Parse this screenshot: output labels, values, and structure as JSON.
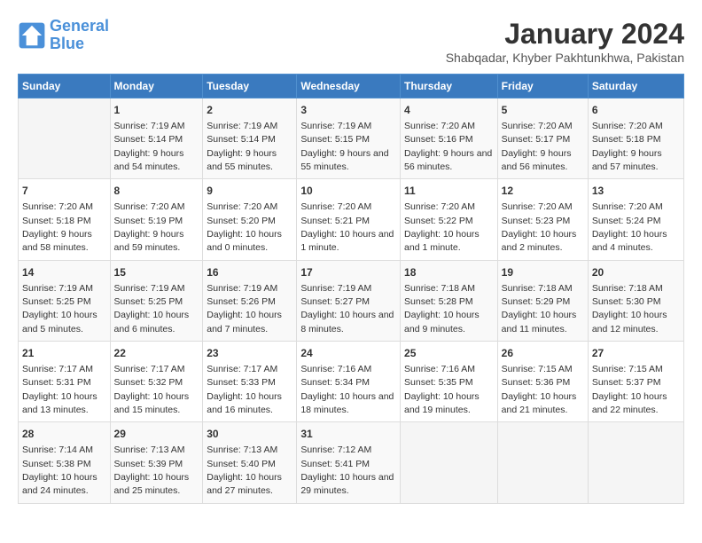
{
  "logo": {
    "line1": "General",
    "line2": "Blue"
  },
  "title": "January 2024",
  "subtitle": "Shabqadar, Khyber Pakhtunkhwa, Pakistan",
  "headers": [
    "Sunday",
    "Monday",
    "Tuesday",
    "Wednesday",
    "Thursday",
    "Friday",
    "Saturday"
  ],
  "weeks": [
    [
      {
        "day": "",
        "sunrise": "",
        "sunset": "",
        "daylight": ""
      },
      {
        "day": "1",
        "sunrise": "Sunrise: 7:19 AM",
        "sunset": "Sunset: 5:14 PM",
        "daylight": "Daylight: 9 hours and 54 minutes."
      },
      {
        "day": "2",
        "sunrise": "Sunrise: 7:19 AM",
        "sunset": "Sunset: 5:14 PM",
        "daylight": "Daylight: 9 hours and 55 minutes."
      },
      {
        "day": "3",
        "sunrise": "Sunrise: 7:19 AM",
        "sunset": "Sunset: 5:15 PM",
        "daylight": "Daylight: 9 hours and 55 minutes."
      },
      {
        "day": "4",
        "sunrise": "Sunrise: 7:20 AM",
        "sunset": "Sunset: 5:16 PM",
        "daylight": "Daylight: 9 hours and 56 minutes."
      },
      {
        "day": "5",
        "sunrise": "Sunrise: 7:20 AM",
        "sunset": "Sunset: 5:17 PM",
        "daylight": "Daylight: 9 hours and 56 minutes."
      },
      {
        "day": "6",
        "sunrise": "Sunrise: 7:20 AM",
        "sunset": "Sunset: 5:18 PM",
        "daylight": "Daylight: 9 hours and 57 minutes."
      }
    ],
    [
      {
        "day": "7",
        "sunrise": "Sunrise: 7:20 AM",
        "sunset": "Sunset: 5:18 PM",
        "daylight": "Daylight: 9 hours and 58 minutes."
      },
      {
        "day": "8",
        "sunrise": "Sunrise: 7:20 AM",
        "sunset": "Sunset: 5:19 PM",
        "daylight": "Daylight: 9 hours and 59 minutes."
      },
      {
        "day": "9",
        "sunrise": "Sunrise: 7:20 AM",
        "sunset": "Sunset: 5:20 PM",
        "daylight": "Daylight: 10 hours and 0 minutes."
      },
      {
        "day": "10",
        "sunrise": "Sunrise: 7:20 AM",
        "sunset": "Sunset: 5:21 PM",
        "daylight": "Daylight: 10 hours and 1 minute."
      },
      {
        "day": "11",
        "sunrise": "Sunrise: 7:20 AM",
        "sunset": "Sunset: 5:22 PM",
        "daylight": "Daylight: 10 hours and 1 minute."
      },
      {
        "day": "12",
        "sunrise": "Sunrise: 7:20 AM",
        "sunset": "Sunset: 5:23 PM",
        "daylight": "Daylight: 10 hours and 2 minutes."
      },
      {
        "day": "13",
        "sunrise": "Sunrise: 7:20 AM",
        "sunset": "Sunset: 5:24 PM",
        "daylight": "Daylight: 10 hours and 4 minutes."
      }
    ],
    [
      {
        "day": "14",
        "sunrise": "Sunrise: 7:19 AM",
        "sunset": "Sunset: 5:25 PM",
        "daylight": "Daylight: 10 hours and 5 minutes."
      },
      {
        "day": "15",
        "sunrise": "Sunrise: 7:19 AM",
        "sunset": "Sunset: 5:25 PM",
        "daylight": "Daylight: 10 hours and 6 minutes."
      },
      {
        "day": "16",
        "sunrise": "Sunrise: 7:19 AM",
        "sunset": "Sunset: 5:26 PM",
        "daylight": "Daylight: 10 hours and 7 minutes."
      },
      {
        "day": "17",
        "sunrise": "Sunrise: 7:19 AM",
        "sunset": "Sunset: 5:27 PM",
        "daylight": "Daylight: 10 hours and 8 minutes."
      },
      {
        "day": "18",
        "sunrise": "Sunrise: 7:18 AM",
        "sunset": "Sunset: 5:28 PM",
        "daylight": "Daylight: 10 hours and 9 minutes."
      },
      {
        "day": "19",
        "sunrise": "Sunrise: 7:18 AM",
        "sunset": "Sunset: 5:29 PM",
        "daylight": "Daylight: 10 hours and 11 minutes."
      },
      {
        "day": "20",
        "sunrise": "Sunrise: 7:18 AM",
        "sunset": "Sunset: 5:30 PM",
        "daylight": "Daylight: 10 hours and 12 minutes."
      }
    ],
    [
      {
        "day": "21",
        "sunrise": "Sunrise: 7:17 AM",
        "sunset": "Sunset: 5:31 PM",
        "daylight": "Daylight: 10 hours and 13 minutes."
      },
      {
        "day": "22",
        "sunrise": "Sunrise: 7:17 AM",
        "sunset": "Sunset: 5:32 PM",
        "daylight": "Daylight: 10 hours and 15 minutes."
      },
      {
        "day": "23",
        "sunrise": "Sunrise: 7:17 AM",
        "sunset": "Sunset: 5:33 PM",
        "daylight": "Daylight: 10 hours and 16 minutes."
      },
      {
        "day": "24",
        "sunrise": "Sunrise: 7:16 AM",
        "sunset": "Sunset: 5:34 PM",
        "daylight": "Daylight: 10 hours and 18 minutes."
      },
      {
        "day": "25",
        "sunrise": "Sunrise: 7:16 AM",
        "sunset": "Sunset: 5:35 PM",
        "daylight": "Daylight: 10 hours and 19 minutes."
      },
      {
        "day": "26",
        "sunrise": "Sunrise: 7:15 AM",
        "sunset": "Sunset: 5:36 PM",
        "daylight": "Daylight: 10 hours and 21 minutes."
      },
      {
        "day": "27",
        "sunrise": "Sunrise: 7:15 AM",
        "sunset": "Sunset: 5:37 PM",
        "daylight": "Daylight: 10 hours and 22 minutes."
      }
    ],
    [
      {
        "day": "28",
        "sunrise": "Sunrise: 7:14 AM",
        "sunset": "Sunset: 5:38 PM",
        "daylight": "Daylight: 10 hours and 24 minutes."
      },
      {
        "day": "29",
        "sunrise": "Sunrise: 7:13 AM",
        "sunset": "Sunset: 5:39 PM",
        "daylight": "Daylight: 10 hours and 25 minutes."
      },
      {
        "day": "30",
        "sunrise": "Sunrise: 7:13 AM",
        "sunset": "Sunset: 5:40 PM",
        "daylight": "Daylight: 10 hours and 27 minutes."
      },
      {
        "day": "31",
        "sunrise": "Sunrise: 7:12 AM",
        "sunset": "Sunset: 5:41 PM",
        "daylight": "Daylight: 10 hours and 29 minutes."
      },
      {
        "day": "",
        "sunrise": "",
        "sunset": "",
        "daylight": ""
      },
      {
        "day": "",
        "sunrise": "",
        "sunset": "",
        "daylight": ""
      },
      {
        "day": "",
        "sunrise": "",
        "sunset": "",
        "daylight": ""
      }
    ]
  ]
}
